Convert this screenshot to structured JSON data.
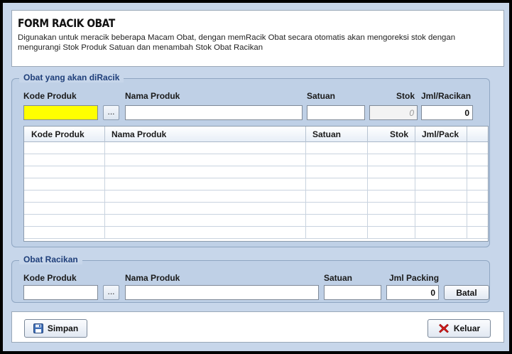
{
  "header": {
    "title": "FORM RACIK OBAT",
    "description": "Digunakan untuk meracik beberapa Macam Obat, dengan memRacik Obat secara otomatis akan mengoreksi stok dengan mengurangi Stok Produk Satuan dan menambah Stok Obat Racikan"
  },
  "group1": {
    "legend": "Obat yang akan diRacik",
    "labels": {
      "kode_produk": "Kode Produk",
      "nama_produk": "Nama Produk",
      "satuan": "Satuan",
      "stok": "Stok",
      "jml_racikan": "Jml/Racikan"
    },
    "values": {
      "kode_produk": "",
      "nama_produk": "",
      "satuan": "",
      "stok": "0",
      "jml_racikan": "0"
    },
    "browse_label": "...",
    "grid": {
      "columns": [
        "Kode Produk",
        "Nama Produk",
        "Satuan",
        "Stok",
        "Jml/Pack"
      ],
      "rows": [
        [],
        [],
        [],
        [],
        [],
        [],
        [],
        []
      ]
    }
  },
  "group2": {
    "legend": "Obat Racikan",
    "labels": {
      "kode_produk": "Kode Produk",
      "nama_produk": "Nama Produk",
      "satuan": "Satuan",
      "jml_packing": "Jml Packing"
    },
    "values": {
      "kode_produk": "",
      "nama_produk": "",
      "satuan": "",
      "jml_packing": "0"
    },
    "browse_label": "...",
    "batal_label": "Batal"
  },
  "footer": {
    "simpan_label": "Simpan",
    "keluar_label": "Keluar"
  },
  "colors": {
    "window_bg": "#c7d6ea",
    "legend_text": "#1f3f7a",
    "highlight_field": "#ffff00",
    "close_icon": "#d11a1a"
  },
  "icons": [
    "save-icon",
    "close-icon"
  ]
}
